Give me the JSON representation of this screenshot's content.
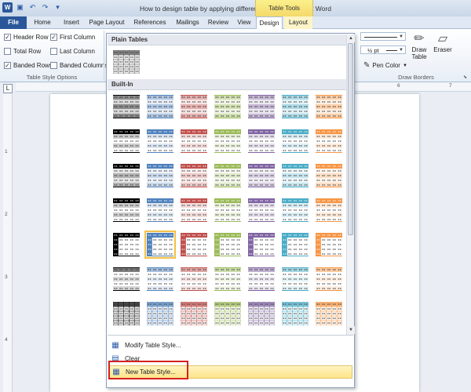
{
  "window": {
    "title": "How to design table by applying different format  -  Microsoft Word",
    "context_tab": "Table Tools",
    "qat_icons": [
      "word-icon",
      "save-icon",
      "undo-icon",
      "redo-icon",
      "customize-icon"
    ]
  },
  "tabs": [
    {
      "label": "File"
    },
    {
      "label": "Home"
    },
    {
      "label": "Insert"
    },
    {
      "label": "Page Layout"
    },
    {
      "label": "References"
    },
    {
      "label": "Mailings"
    },
    {
      "label": "Review"
    },
    {
      "label": "View"
    },
    {
      "label": "Design"
    },
    {
      "label": "Layout"
    }
  ],
  "table_style_options": {
    "group_label": "Table Style Options",
    "options": [
      {
        "label": "Header Row",
        "checked": true
      },
      {
        "label": "First Column",
        "checked": true
      },
      {
        "label": "Total Row",
        "checked": false
      },
      {
        "label": "Last Column",
        "checked": false
      },
      {
        "label": "Banded Rows",
        "checked": true
      },
      {
        "label": "Banded Columns",
        "checked": false
      }
    ]
  },
  "draw_borders": {
    "group_label": "Draw Borders",
    "weight": "½ pt",
    "pen_color": "Pen Color",
    "draw_table": "Draw Table",
    "eraser": "Eraser"
  },
  "ruler": {
    "marks": [
      "1",
      "2",
      "3",
      "4",
      "5",
      "6",
      "7"
    ]
  },
  "gallery": {
    "plain_header": "Plain Tables",
    "builtin_header": "Built-In",
    "colors": [
      "#000000",
      "#4f81bd",
      "#c0504d",
      "#9bbb59",
      "#8064a2",
      "#4bacc6",
      "#f79646"
    ],
    "rows": [
      {
        "style": "shade"
      },
      {
        "style": "header"
      },
      {
        "style": "band"
      },
      {
        "style": "header"
      },
      {
        "style": "firstcol"
      },
      {
        "style": "light"
      },
      {
        "style": "grid"
      }
    ],
    "selected": {
      "row": 4,
      "col": 1
    }
  },
  "menu": [
    {
      "label": "Modify Table Style...",
      "icon": "modify-style-icon"
    },
    {
      "label": "Clear",
      "icon": "clear-style-icon"
    },
    {
      "label": "New Table Style...",
      "icon": "new-style-icon"
    }
  ]
}
